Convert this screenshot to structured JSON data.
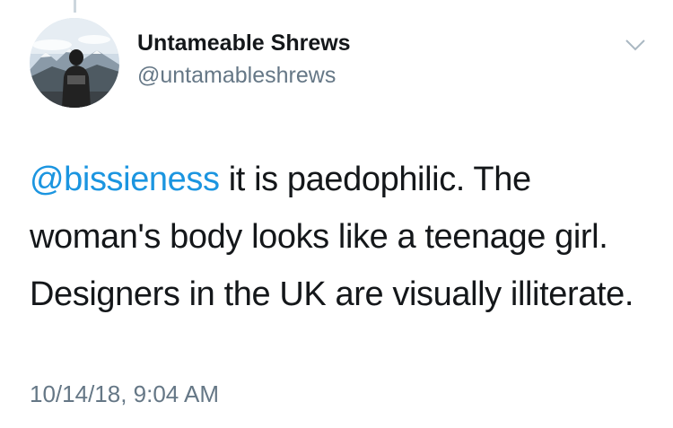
{
  "author": {
    "display_name": "Untameable Shrews",
    "handle": "@untamableshrews",
    "avatar_icon": "profile-photo-person-mountains"
  },
  "menu": {
    "icon": "chevron-down-icon"
  },
  "tweet": {
    "mention": "@bissieness",
    "text": " it is paedophilic. The woman's body looks like a teenage girl. Designers in the UK are visually illiterate.",
    "timestamp": "10/14/18, 9:04 AM"
  },
  "colors": {
    "link": "#1b95e0",
    "secondary_text": "#657786",
    "primary_text": "#14171a"
  }
}
